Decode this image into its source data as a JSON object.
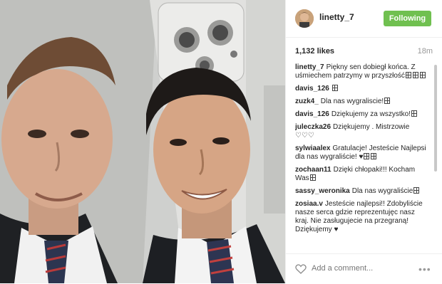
{
  "header": {
    "username": "linetty_7",
    "follow_label": "Following"
  },
  "stats": {
    "likes": "1,132 likes",
    "time_ago": "18m"
  },
  "comments": [
    {
      "user": "linetty_7",
      "text": "Piękny sen dobiegł końca. Z uśmiechem patrzymy w przyszłość",
      "emoji_after": 3
    },
    {
      "user": "davis_126",
      "text": "",
      "emoji_after": 1
    },
    {
      "user": "zuzk4_",
      "text": "Dla nas wygraliscie!",
      "emoji_after": 1
    },
    {
      "user": "davis_126",
      "text": "Dziękujemy za wszystko!",
      "emoji_after": 1
    },
    {
      "user": "juleczka26",
      "text": "Dziękujemy . Mistrzowie ♡♡♡",
      "emoji_after": 0
    },
    {
      "user": "sylwiaalex",
      "text": "Gratulacje! Jesteście Najlepsi dla nas wygraliście! ♥",
      "emoji_after": 2
    },
    {
      "user": "zochaan11",
      "text": "Dzięki chłopaki!!! Kocham Was",
      "emoji_after": 1
    },
    {
      "user": "sassy_weronika",
      "text": "Dla nas wygraliście",
      "emoji_after": 1
    },
    {
      "user": "zosiaa.v",
      "text": "Jesteście najlepsi!! Zdobyliście nasze serca gdzie reprezentujęc nasz kraj. Nie zasługujecie na przegraną! Dziękujemy ♥",
      "emoji_after": 0
    }
  ],
  "footer": {
    "add_comment_placeholder": "Add a comment...",
    "more_label": "•••"
  },
  "icons": {
    "heart": "heart-icon",
    "more": "more-options-icon"
  },
  "colors": {
    "follow_button": "#70c050"
  }
}
